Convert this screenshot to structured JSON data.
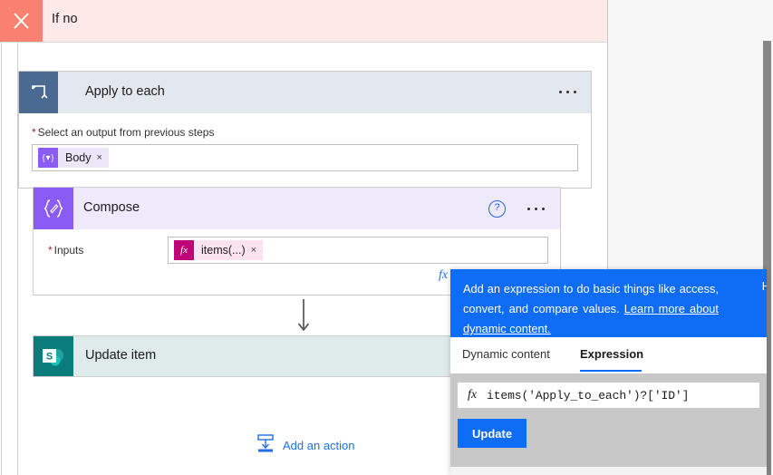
{
  "header": {
    "title": "If no",
    "close_icon": "close-x-icon",
    "accent_color": "#fa8072",
    "background_color": "#fdeae8"
  },
  "apply_to_each": {
    "title": "Apply to each",
    "icon": "loop-repeat-icon",
    "icon_color": "#4a6a92",
    "header_color": "#e3e8ef",
    "overflow_menu": "ellipsis-icon",
    "field_label": "Select an output from previous steps",
    "required_marker": "*",
    "token": {
      "icon": "dynamic-content-icon",
      "label": "Body",
      "remove": "×",
      "color": "#8a5cf5"
    }
  },
  "compose": {
    "title": "Compose",
    "icon": "compose-braces-icon",
    "icon_color": "#8a5cf5",
    "header_color": "#eeeafc",
    "help_icon": "question-circle-icon",
    "overflow_menu": "ellipsis-icon",
    "inputs_label": "Inputs",
    "required_marker": "*",
    "token": {
      "icon": "fx-expression-icon",
      "label": "items(...)",
      "remove": "×",
      "color": "#bf0077"
    },
    "stray_fx": "fx"
  },
  "update_item": {
    "title": "Update item",
    "icon": "sharepoint-icon",
    "icon_color": "#0a7c7c",
    "card_color": "#dfeaea"
  },
  "add_action": {
    "label": "Add an action",
    "icon": "insert-below-icon",
    "color": "#1f6fe5"
  },
  "flyout": {
    "banner": {
      "text_before_link": "Add an expression to do basic things like access, convert, and compare values. ",
      "link_text": "Learn more about dynamic content.",
      "hide_label": "H",
      "background_color": "#0f6cf5"
    },
    "tabs": [
      {
        "label": "Dynamic content",
        "selected": false
      },
      {
        "label": "Expression",
        "selected": true
      }
    ],
    "expression_editor": {
      "fx_icon": "fx",
      "value": "items('Apply_to_each')?['ID']",
      "placeholder": ""
    },
    "update_button": "Update"
  },
  "scrollbar": {
    "name": "vertical-scrollbar",
    "thumb_color": "#878787"
  }
}
